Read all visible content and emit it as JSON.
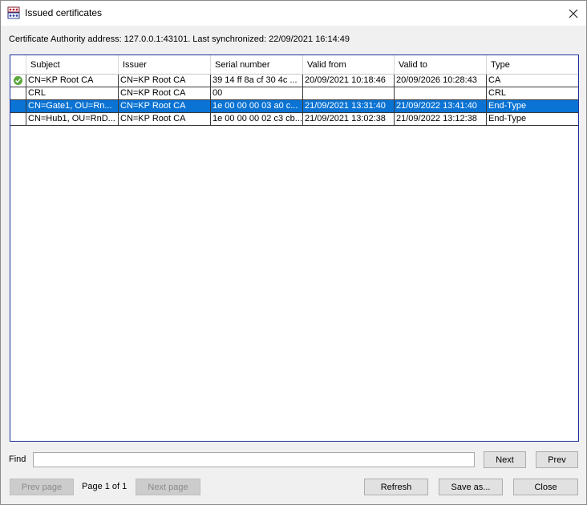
{
  "window": {
    "title": "Issued certificates"
  },
  "info": {
    "text": "Certificate Authority address: 127.0.0.1:43101. Last synchronized: 22/09/2021 16:14:49"
  },
  "table": {
    "columns": [
      "",
      "Subject",
      "Issuer",
      "Serial number",
      "Valid from",
      "Valid to",
      "Type"
    ],
    "rows": [
      {
        "status_icon": "check-circle-icon",
        "subject": "CN=KP Root CA",
        "issuer": "CN=KP Root CA",
        "serial": "39 14 ff 8a cf 30 4c ...",
        "valid_from": "20/09/2021 10:18:46",
        "valid_to": "20/09/2026 10:28:43",
        "type": "CA",
        "selected": false
      },
      {
        "status_icon": "",
        "subject": "CRL",
        "issuer": "CN=KP Root CA",
        "serial": "00",
        "valid_from": "",
        "valid_to": "",
        "type": "CRL",
        "selected": false
      },
      {
        "status_icon": "",
        "subject": "CN=Gate1, OU=Rn...",
        "issuer": "CN=KP Root CA",
        "serial": "1e 00 00 00 03 a0 c...",
        "valid_from": "21/09/2021 13:31:40",
        "valid_to": "21/09/2022 13:41:40",
        "type": "End-Type",
        "selected": true
      },
      {
        "status_icon": "",
        "subject": "CN=Hub1, OU=RnD...",
        "issuer": "CN=KP Root CA",
        "serial": "1e 00 00 00 02 c3 cb...",
        "valid_from": "21/09/2021 13:02:38",
        "valid_to": "21/09/2022 13:12:38",
        "type": "End-Type",
        "selected": false
      }
    ]
  },
  "find": {
    "label": "Find",
    "value": "",
    "placeholder": ""
  },
  "buttons": {
    "next": "Next",
    "prev": "Prev",
    "prev_page": "Prev page",
    "next_page": "Next page",
    "refresh": "Refresh",
    "save_as": "Save as...",
    "close": "Close"
  },
  "pagination": {
    "text": "Page 1 of 1"
  },
  "colors": {
    "selection": "#0a73d4",
    "frame": "#1c2fa0",
    "ok": "#5aa83a"
  }
}
